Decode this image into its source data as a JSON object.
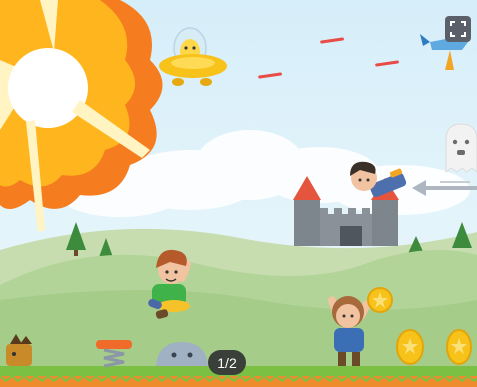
{
  "game": {
    "page_indicator": "1/2"
  },
  "colors": {
    "sky": "#dff1fb",
    "hill_back": "#c4dca8",
    "hill_front": "#a9d08e",
    "grass": "#7dc242",
    "dirt": "#f08a2a",
    "explosion_outer": "#f57c1f",
    "explosion_mid": "#ffb51d",
    "explosion_inner": "#fff4c2",
    "castle": "#7a8189",
    "roof": "#e8513a",
    "coin": "#f7c21a"
  },
  "icons": {
    "fullscreen": "fullscreen-icon",
    "ufo": "ufo-icon",
    "ghost": "ghost-icon",
    "coin": "coin-icon",
    "spring": "spring-icon",
    "arrow": "arrow-icon"
  }
}
